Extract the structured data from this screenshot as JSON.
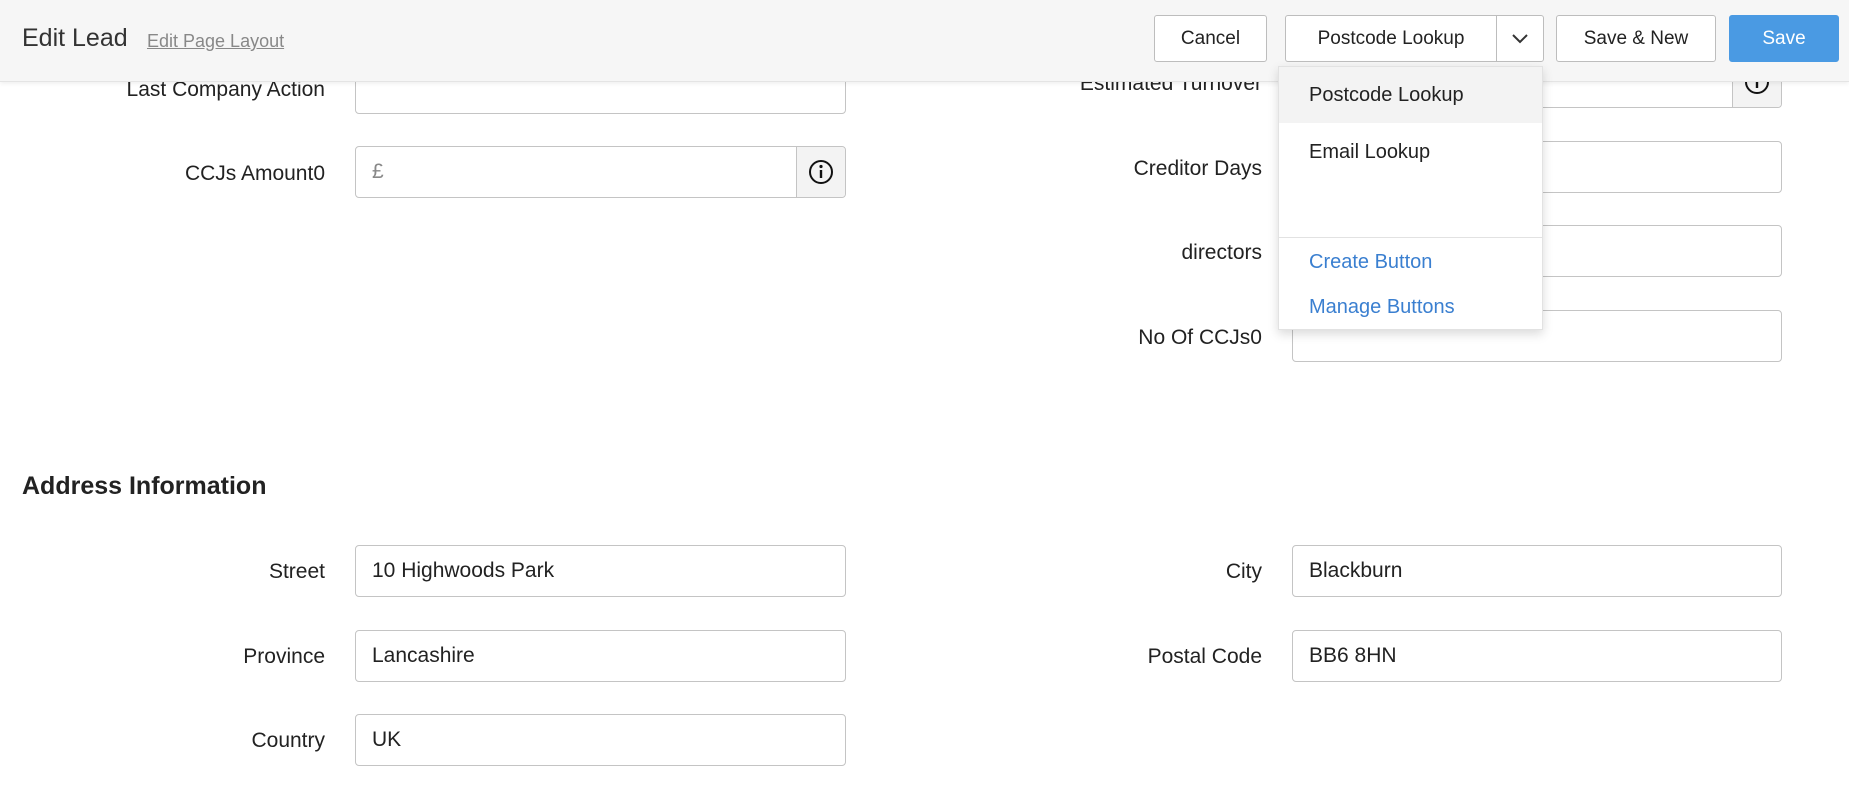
{
  "header": {
    "title": "Edit Lead",
    "layout_link": "Edit Page Layout",
    "cancel_label": "Cancel",
    "lookup_label": "Postcode Lookup",
    "save_new_label": "Save & New",
    "save_label": "Save",
    "save_color": "#4a9ae3"
  },
  "dropdown": {
    "items": [
      "Postcode Lookup",
      "Email Lookup"
    ],
    "create_label": "Create Button",
    "manage_label": "Manage Buttons",
    "link_color": "#3a7fd0"
  },
  "form": {
    "last_company_action": {
      "label": "Last Company Action",
      "value": ""
    },
    "ccjs_amount": {
      "label": "CCJs Amount0",
      "currency": "£",
      "value": ""
    },
    "estimated_turnover": {
      "label": "Estimated Turnover",
      "value": ""
    },
    "creditor_days": {
      "label": "Creditor Days",
      "value": ""
    },
    "directors": {
      "label": "directors",
      "value": ""
    },
    "no_of_ccjs": {
      "label": "No Of CCJs0",
      "value": ""
    }
  },
  "address": {
    "title": "Address Information",
    "street": {
      "label": "Street",
      "value": "10 Highwoods Park"
    },
    "city": {
      "label": "City",
      "value": "Blackburn"
    },
    "province": {
      "label": "Province",
      "value": "Lancashire"
    },
    "postal_code": {
      "label": "Postal Code",
      "value": "BB6 8HN"
    },
    "country": {
      "label": "Country",
      "value": "UK"
    }
  }
}
